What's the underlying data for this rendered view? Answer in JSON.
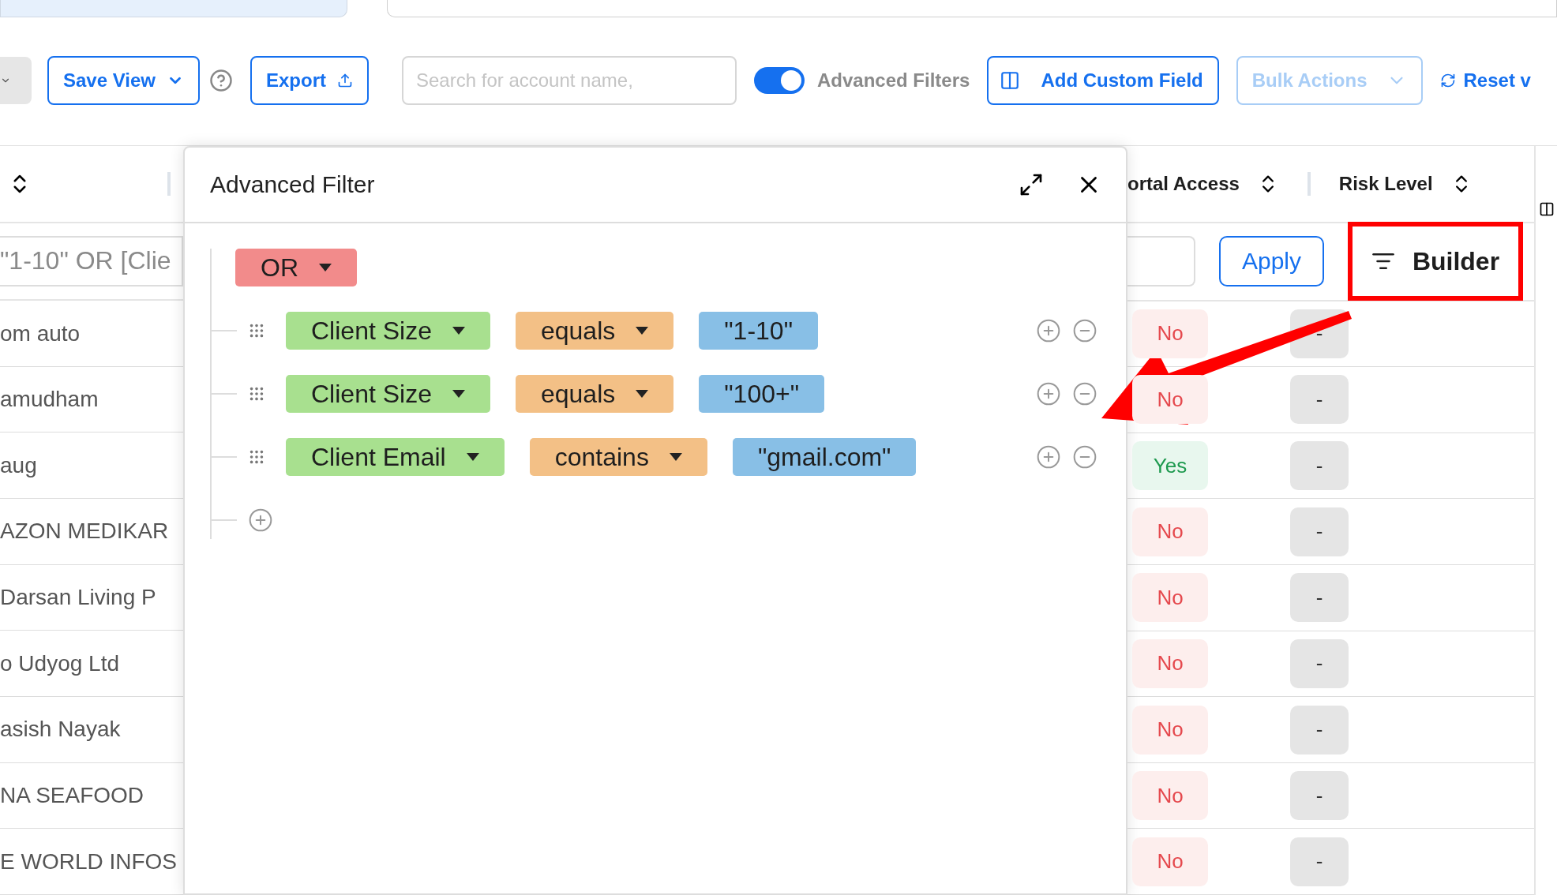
{
  "toolbar": {
    "save_view": "Save View",
    "export": "Export",
    "search": {
      "placeholder": "Search for account name,"
    },
    "advanced_filters": {
      "label": "Advanced Filters",
      "on": true
    },
    "add_custom_field": "Add Custom Field",
    "bulk_actions": {
      "label": "Bulk Actions",
      "disabled": true
    },
    "reset": "Reset v"
  },
  "table": {
    "columns": [
      {
        "label": "ortal Access"
      },
      {
        "label": "Risk Level"
      }
    ],
    "filter_value": "\"1-10\" OR [Clie",
    "apply": "Apply",
    "builder": {
      "label": "Builder",
      "highlighted": true
    },
    "rows": [
      {
        "name": "om auto",
        "portal_access": "No",
        "granted": false,
        "risk_level": "-"
      },
      {
        "name": "amudham",
        "portal_access": "No",
        "granted": false,
        "risk_level": "-"
      },
      {
        "name": "aug",
        "portal_access": "Yes",
        "granted": true,
        "risk_level": "-"
      },
      {
        "name": "AZON MEDIKAR",
        "portal_access": "No",
        "granted": false,
        "risk_level": "-"
      },
      {
        "name": "Darsan Living P",
        "portal_access": "No",
        "granted": false,
        "risk_level": "-"
      },
      {
        "name": "o Udyog Ltd",
        "portal_access": "No",
        "granted": false,
        "risk_level": "-"
      },
      {
        "name": "asish Nayak",
        "portal_access": "No",
        "granted": false,
        "risk_level": "-"
      },
      {
        "name": "NA SEAFOOD",
        "portal_access": "No",
        "granted": false,
        "risk_level": "-"
      },
      {
        "name": "E WORLD INFOS",
        "portal_access": "No",
        "granted": false,
        "risk_level": "-"
      }
    ]
  },
  "modal": {
    "title": "Advanced Filter",
    "combinator": "OR",
    "rules": [
      {
        "field": "Client Size",
        "operator": "equals",
        "value": "\"1-10\""
      },
      {
        "field": "Client Size",
        "operator": "equals",
        "value": "\"100+\""
      },
      {
        "field": "Client Email",
        "operator": "contains",
        "value": "\"gmail.com\""
      }
    ]
  }
}
